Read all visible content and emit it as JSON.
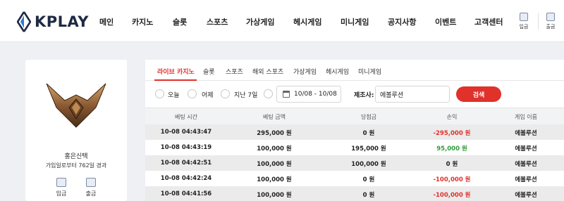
{
  "brand": {
    "name": "KPLAY"
  },
  "nav": [
    {
      "label": "메인"
    },
    {
      "label": "카지노"
    },
    {
      "label": "슬롯"
    },
    {
      "label": "스포츠"
    },
    {
      "label": "가상게임"
    },
    {
      "label": "헤시게임"
    },
    {
      "label": "미니게임"
    },
    {
      "label": "공지사항"
    },
    {
      "label": "이벤트"
    },
    {
      "label": "고객센터"
    }
  ],
  "header_actions": {
    "deposit": "입금",
    "withdraw": "출금"
  },
  "profile": {
    "nickname": "홍은신택",
    "joined": "가입일로부터 762일 경과",
    "deposit": "입금",
    "withdraw": "출금"
  },
  "tabs": [
    {
      "label": "라이브 카지노",
      "active": true
    },
    {
      "label": "슬롯"
    },
    {
      "label": "스포츠"
    },
    {
      "label": "해외 스포츠"
    },
    {
      "label": "가상게임"
    },
    {
      "label": "헤시게임"
    },
    {
      "label": "미니게임"
    }
  ],
  "filters": {
    "today": "오늘",
    "yesterday": "어제",
    "last7": "지난 7일",
    "date_range": "10/08 - 10/08",
    "vendor_label": "제조사:",
    "vendor_value": "에볼루션",
    "search": "검색"
  },
  "table": {
    "headers": [
      "베팅 시간",
      "베팅 금액",
      "당첨금",
      "손익",
      "게임 이름"
    ],
    "rows": [
      [
        "10-08 04:43:47",
        "295,000 원",
        "0 원",
        "-295,000 원",
        "에볼루션"
      ],
      [
        "10-08 04:43:19",
        "100,000 원",
        "195,000 원",
        "95,000 원",
        "에볼루션"
      ],
      [
        "10-08 04:42:51",
        "100,000 원",
        "100,000 원",
        "0 원",
        "에볼루션"
      ],
      [
        "10-08 04:42:24",
        "100,000 원",
        "0 원",
        "-100,000 원",
        "에볼루션"
      ],
      [
        "10-08 04:41:56",
        "100,000 원",
        "0 원",
        "-100,000 원",
        "에볼루션"
      ]
    ],
    "profit_colors": {
      "negative": "#e0312b",
      "positive": "#2e9e3a"
    }
  },
  "colors": {
    "accent": "#e0312b",
    "logo": "#1f2a44",
    "logo_mark": "#2b7bd6"
  },
  "icons": {
    "deposit": "wallet-icon",
    "withdraw": "wallet-icon",
    "calendar": "calendar-icon",
    "emblem": "rank-emblem"
  }
}
